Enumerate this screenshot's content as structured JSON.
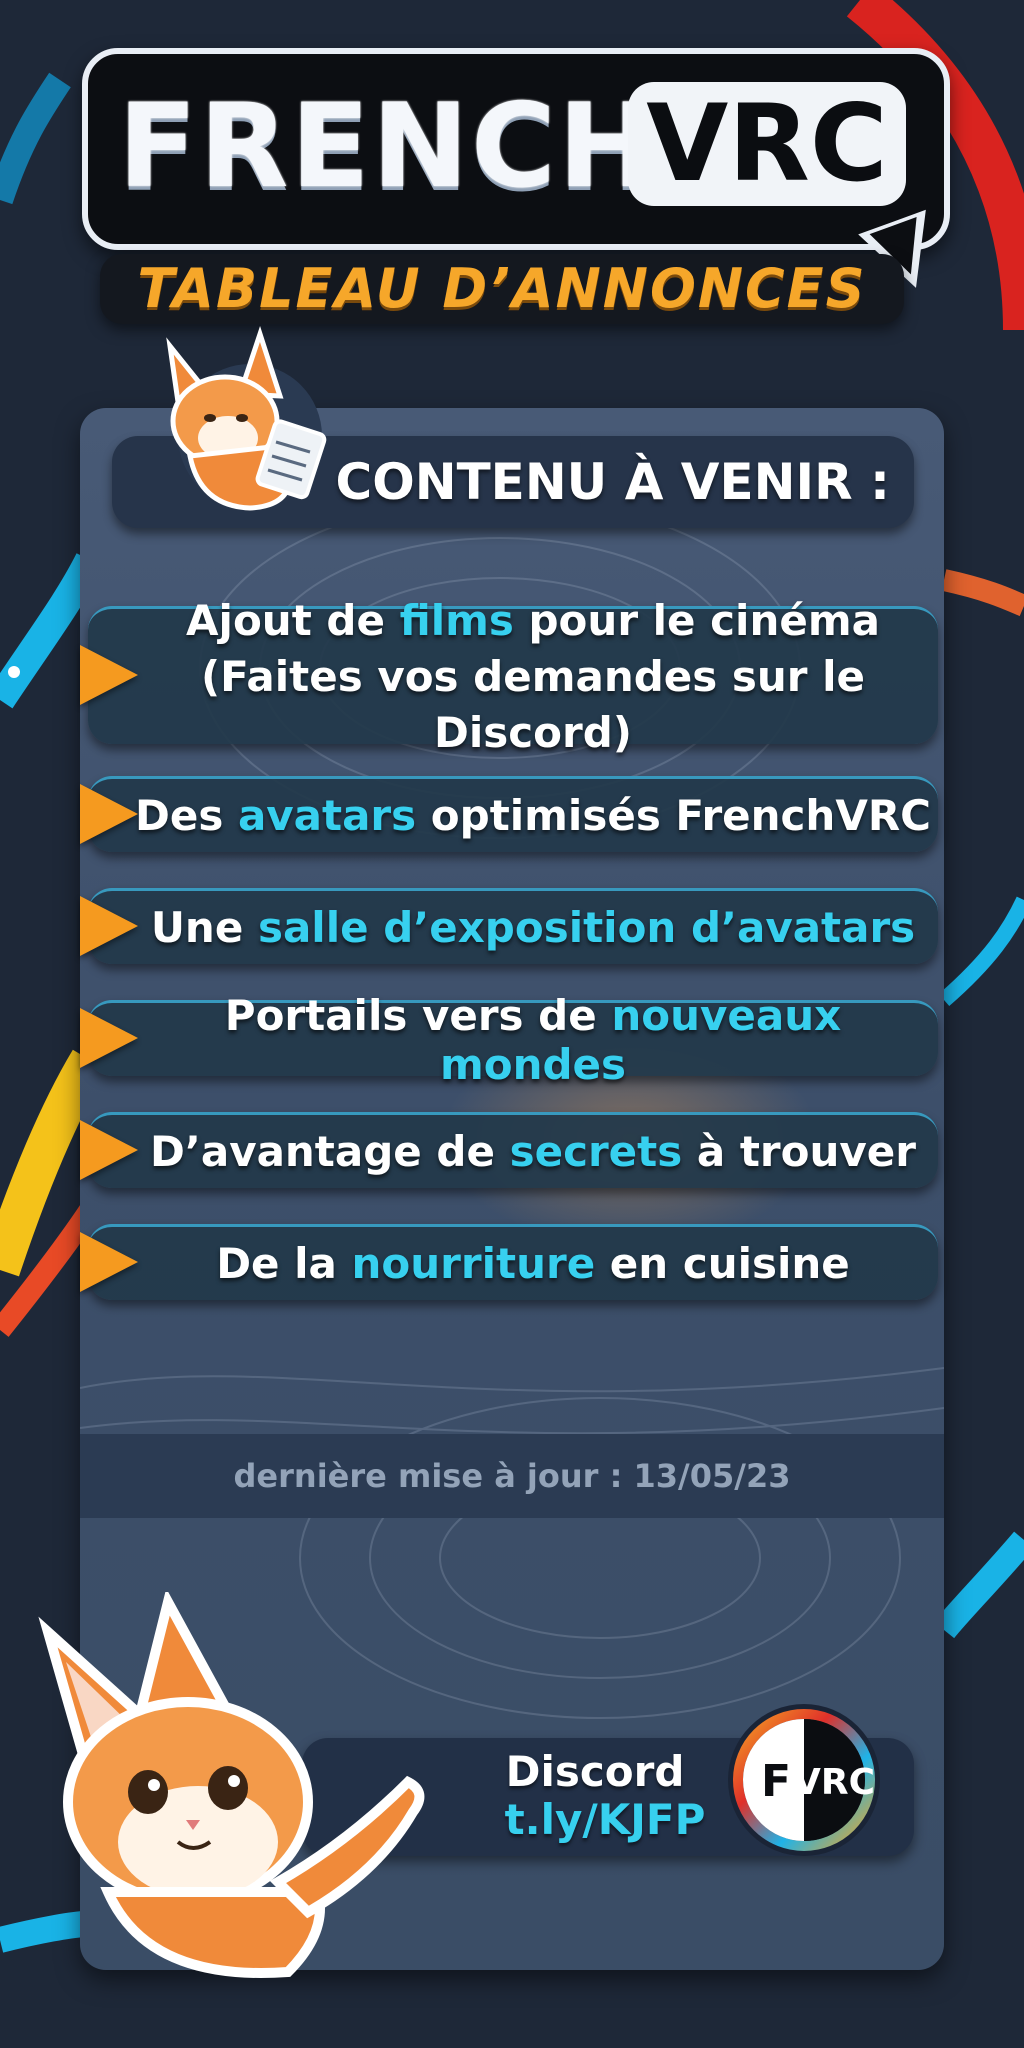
{
  "header": {
    "brand_word": "FRENCH",
    "brand_badge": "VRC",
    "subtitle": "TABLEAU D’ANNONCES"
  },
  "section": {
    "title": "CONTENU À VENIR :"
  },
  "items": [
    {
      "line1_parts": [
        "Ajout de ",
        "films",
        " pour le cinéma"
      ],
      "line2": "(Faites vos demandes sur le Discord)"
    },
    {
      "parts": [
        "Des ",
        "avatars",
        " optimisés FrenchVRC"
      ]
    },
    {
      "parts": [
        "Une ",
        "salle d’exposition d’avatars",
        ""
      ]
    },
    {
      "parts": [
        "Portails vers de ",
        "nouveaux mondes",
        ""
      ]
    },
    {
      "parts": [
        "D’avantage de ",
        "secrets",
        " à trouver"
      ]
    },
    {
      "parts": [
        "De la ",
        "nourriture",
        " en cuisine"
      ]
    }
  ],
  "footer": {
    "last_update": "dernière mise à jour : 13/05/23"
  },
  "discord": {
    "label": "Discord",
    "link": "t.ly/KJFP"
  },
  "logo": {
    "letter": "F",
    "text": "VRC"
  },
  "colors": {
    "background": "#1e2838",
    "panel": "#3d4f6a",
    "highlight": "#37d0ef",
    "arrow": "#f59a1f",
    "subtitle": "#f6a72a"
  },
  "icons": [
    "fox-mascot-notepad",
    "fox-mascot-pointing",
    "play-arrow-icon",
    "fvrc-logo"
  ]
}
